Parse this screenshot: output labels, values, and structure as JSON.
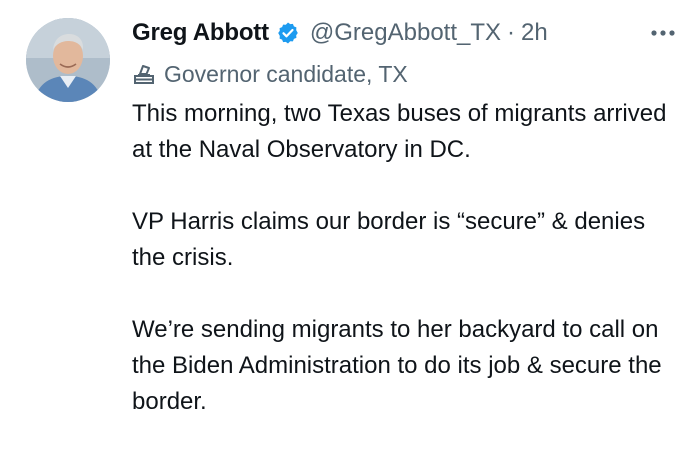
{
  "tweet": {
    "author_name": "Greg Abbott",
    "handle": "@GregAbbott_TX",
    "separator": "·",
    "time": "2h",
    "label": "Governor candidate, TX",
    "paragraphs": [
      "This morning, two Texas buses of migrants arrived at the Naval Observatory in DC.",
      "VP Harris claims our border is “secure” & denies the crisis.",
      "We’re sending migrants to her backyard to call on the Biden Administration to do its job & secure the border."
    ]
  },
  "icons": {
    "verified": "verified-badge-icon",
    "label": "ballot-box-icon",
    "more": "more-options-icon"
  },
  "colors": {
    "verified_blue": "#1d9bf0",
    "secondary_text": "#536471",
    "primary_text": "#0f1419"
  }
}
